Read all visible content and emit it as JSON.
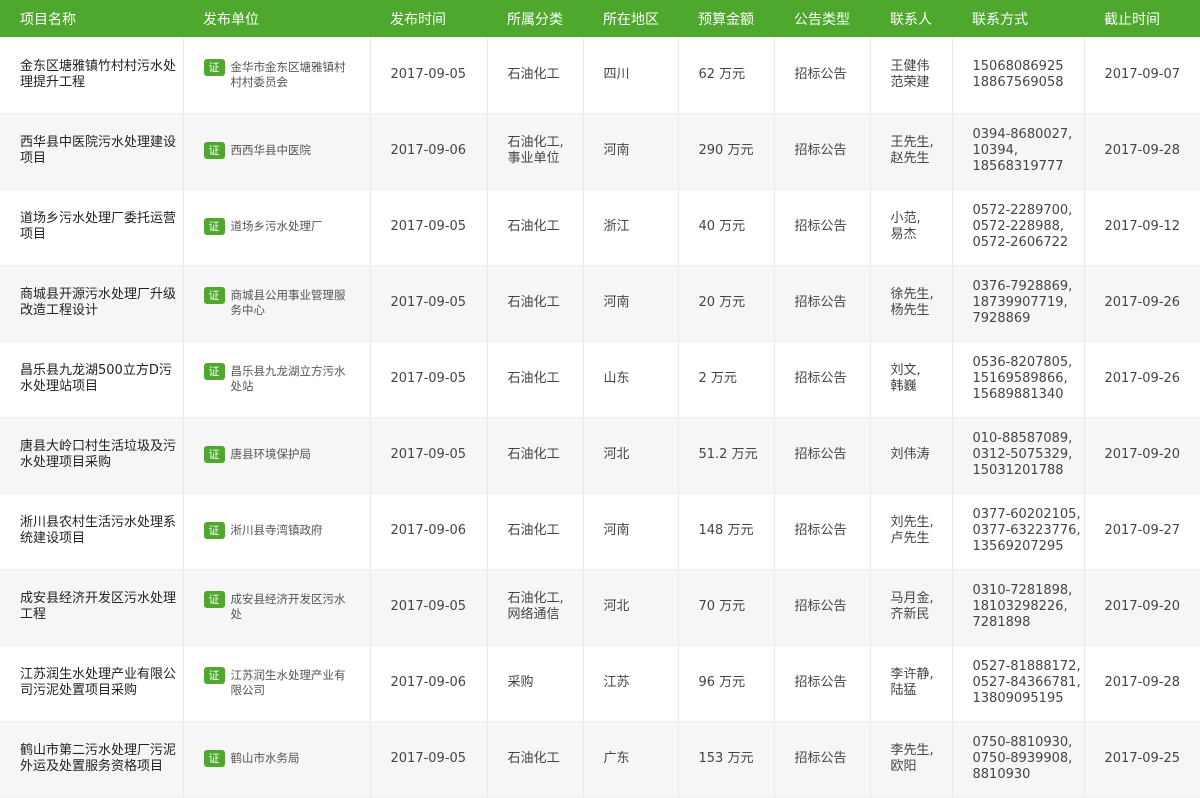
{
  "header": [
    "项目名称",
    "发布单位",
    "发布时间",
    "所属分类",
    "所在地区",
    "预算金额",
    "公告类型",
    "联系人",
    "联系方式",
    "截止时间"
  ],
  "cert_label": "证",
  "rows": [
    {
      "name": "金东区塘雅镇竹村村污水处理提升工程",
      "unit": "金华市金东区塘雅镇村村村委员会",
      "date": "2017-09-05",
      "category": "石油化工",
      "region": "四川",
      "budget": "62 万元",
      "type": "招标公告",
      "contact": "王健伟\n范荣建",
      "phone": "15068086925\n18867569058",
      "deadline": "2017-09-07"
    },
    {
      "name": "西华县中医院污水处理建设项目",
      "unit": "西西华县中医院",
      "date": "2017-09-06",
      "category": "石油化工,\n事业单位",
      "region": "河南",
      "budget": "290 万元",
      "type": "招标公告",
      "contact": "王先生,\n赵先生",
      "phone": "0394-8680027,\n10394,\n18568319777",
      "deadline": "2017-09-28"
    },
    {
      "name": "道场乡污水处理厂委托运营项目",
      "unit": "道场乡污水处理厂",
      "date": "2017-09-05",
      "category": "石油化工",
      "region": "浙江",
      "budget": "40 万元",
      "type": "招标公告",
      "contact": "小范,\n易杰",
      "phone": "0572-2289700,\n0572-228988,\n0572-2606722",
      "deadline": "2017-09-12"
    },
    {
      "name": "商城县开源污水处理厂升级改造工程设计",
      "unit": "商城县公用事业管理服务中心",
      "date": "2017-09-05",
      "category": "石油化工",
      "region": "河南",
      "budget": "20 万元",
      "type": "招标公告",
      "contact": "徐先生,\n杨先生",
      "phone": "0376-7928869,\n18739907719,\n7928869",
      "deadline": "2017-09-26"
    },
    {
      "name": "昌乐县九龙湖500立方D污水处理站项目",
      "unit": "昌乐县九龙湖立方污水处站",
      "date": "2017-09-05",
      "category": "石油化工",
      "region": "山东",
      "budget": "2 万元",
      "type": "招标公告",
      "contact": "刘文,\n韩巍",
      "phone": "0536-8207805,\n15169589866,\n15689881340",
      "deadline": "2017-09-26"
    },
    {
      "name": "唐县大岭口村生活垃圾及污水处理项目采购",
      "unit": "唐县环境保护局",
      "date": "2017-09-05",
      "category": "石油化工",
      "region": "河北",
      "budget": "51.2 万元",
      "type": "招标公告",
      "contact": "刘伟涛",
      "phone": "010-88587089,\n0312-5075329,\n15031201788",
      "deadline": "2017-09-20"
    },
    {
      "name": "淅川县农村生活污水处理系统建设项目",
      "unit": "淅川县寺湾镇政府",
      "date": "2017-09-06",
      "category": "石油化工",
      "region": "河南",
      "budget": "148 万元",
      "type": "招标公告",
      "contact": "刘先生,\n卢先生",
      "phone": "0377-60202105,\n0377-63223776,\n13569207295",
      "deadline": "2017-09-27"
    },
    {
      "name": "成安县经济开发区污水处理工程",
      "unit": "成安县经济开发区污水处",
      "date": "2017-09-05",
      "category": "石油化工,\n网络通信",
      "region": "河北",
      "budget": "70 万元",
      "type": "招标公告",
      "contact": "马月金,\n齐新民",
      "phone": "0310-7281898,\n18103298226,\n7281898",
      "deadline": "2017-09-20"
    },
    {
      "name": "江苏润生水处理产业有限公司污泥处置项目采购",
      "unit": "江苏润生水处理产业有限公司",
      "date": "2017-09-06",
      "category": "采购",
      "region": "江苏",
      "budget": "96 万元",
      "type": "招标公告",
      "contact": "李许静,\n陆猛",
      "phone": "0527-81888172,\n0527-84366781,\n13809095195",
      "deadline": "2017-09-28"
    },
    {
      "name": "鹤山市第二污水处理厂污泥外运及处置服务资格项目",
      "unit": "鹤山市水务局",
      "date": "2017-09-05",
      "category": "石油化工",
      "region": "广东",
      "budget": "153 万元",
      "type": "招标公告",
      "contact": "李先生,\n欧阳",
      "phone": "0750-8810930,\n0750-8939908,\n8810930",
      "deadline": "2017-09-25"
    }
  ]
}
